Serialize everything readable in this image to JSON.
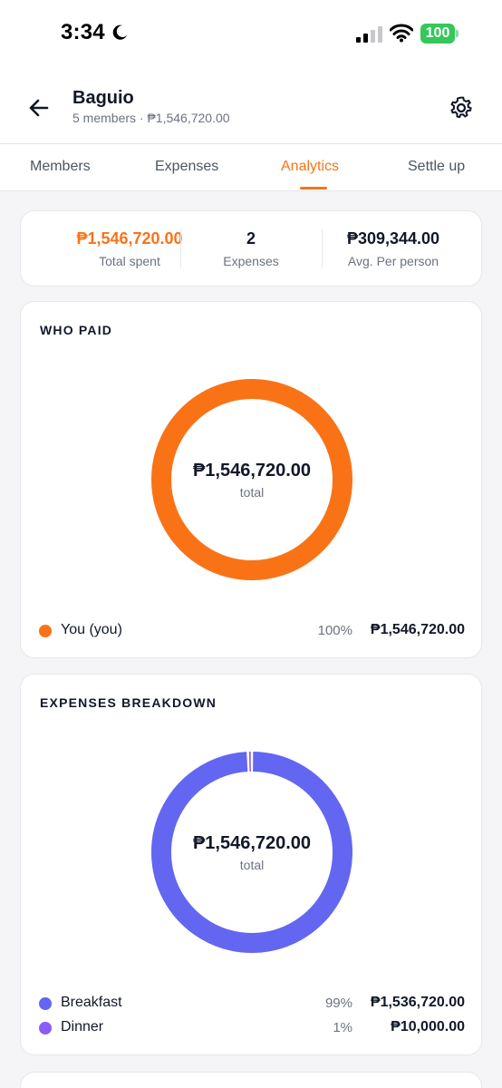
{
  "status_bar": {
    "time": "3:34",
    "battery": "100"
  },
  "header": {
    "title": "Baguio",
    "subtitle": "5 members · ₱1,546,720.00"
  },
  "tabs": [
    {
      "label": "Members",
      "active": false
    },
    {
      "label": "Expenses",
      "active": false
    },
    {
      "label": "Analytics",
      "active": true
    },
    {
      "label": "Settle up",
      "active": false
    }
  ],
  "summary": [
    {
      "value": "₱1,546,720.00",
      "label": "Total spent"
    },
    {
      "value": "2",
      "label": "Expenses"
    },
    {
      "value": "₱309,344.00",
      "label": "Avg. Per person"
    }
  ],
  "who_paid": {
    "title": "WHO PAID",
    "total": "₱1,546,720.00",
    "caption": "total",
    "items": [
      {
        "name": "You (you)",
        "percent": "100%",
        "amount": "₱1,546,720.00",
        "share": 1.0,
        "color": "#f97316"
      }
    ]
  },
  "breakdown": {
    "title": "EXPENSES BREAKDOWN",
    "total": "₱1,546,720.00",
    "caption": "total",
    "items": [
      {
        "name": "Breakfast",
        "percent": "99%",
        "amount": "₱1,536,720.00",
        "share": 0.9935,
        "color": "#6366f1"
      },
      {
        "name": "Dinner",
        "percent": "1%",
        "amount": "₱10,000.00",
        "share": 0.0065,
        "color": "#8b5cf6"
      }
    ]
  },
  "colors": {
    "accent": "#f97316",
    "breakfast": "#6366f1",
    "dinner": "#8b5cf6"
  },
  "icons": {
    "back": "arrow-left-icon",
    "settings": "gear-icon",
    "moon": "moon-icon"
  }
}
